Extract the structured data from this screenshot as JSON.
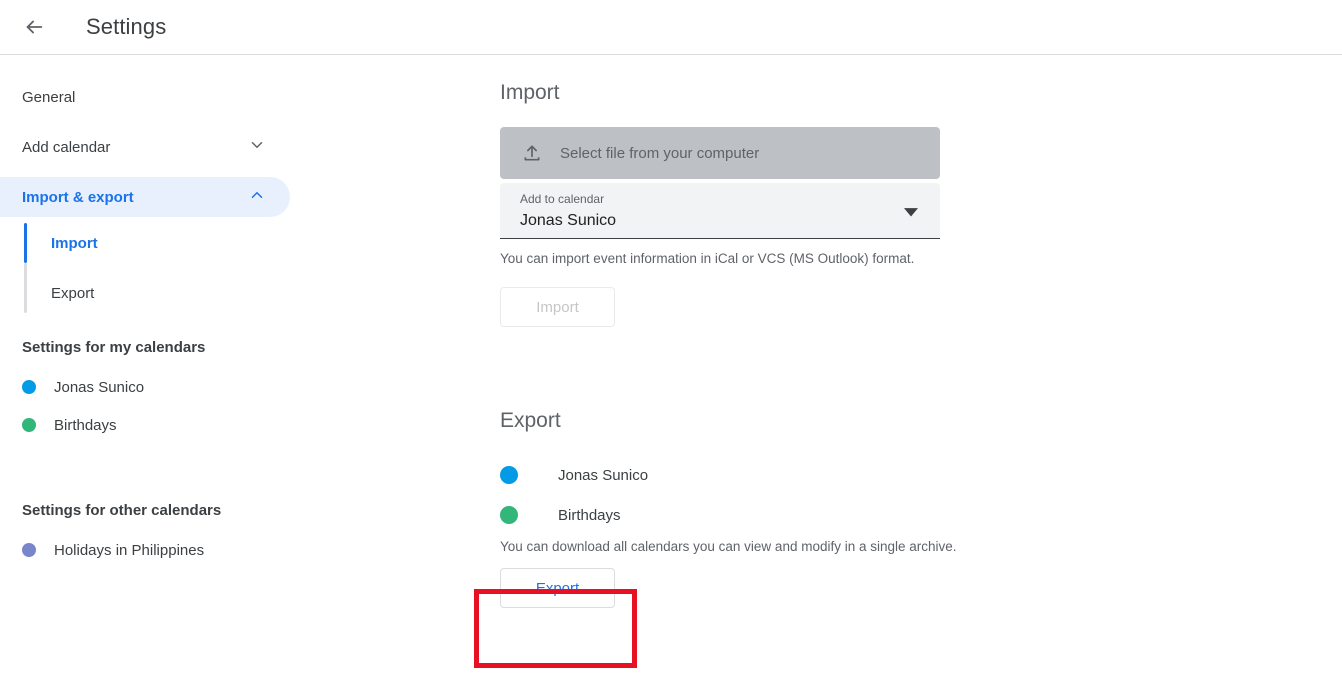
{
  "header": {
    "title": "Settings",
    "back_icon": "arrow-left-icon"
  },
  "sidebar": {
    "nav": [
      {
        "label": "General",
        "icon": null,
        "active": false
      },
      {
        "label": "Add calendar",
        "icon": "chevron-down-icon",
        "active": false
      },
      {
        "label": "Import & export",
        "icon": "chevron-up-icon",
        "active": true
      }
    ],
    "subnav": [
      {
        "label": "Import",
        "active": true
      },
      {
        "label": "Export",
        "active": false
      }
    ],
    "my_calendars_title": "Settings for my calendars",
    "my_calendars": [
      {
        "name": "Jonas Sunico",
        "color": "#039be5"
      },
      {
        "name": "Birthdays",
        "color": "#33b679"
      }
    ],
    "other_calendars_title": "Settings for other calendars",
    "other_calendars": [
      {
        "name": "Holidays in Philippines",
        "color": "#7986cb"
      }
    ]
  },
  "main": {
    "import": {
      "heading": "Import",
      "select_file_label": "Select file from your computer",
      "select_file_icon": "file-upload-icon",
      "add_to_calendar_label": "Add to calendar",
      "add_to_calendar_value": "Jonas Sunico",
      "dropdown_icon": "dropdown-arrow-icon",
      "helper_text": "You can import event information in iCal or VCS (MS Outlook) format.",
      "import_button_label": "Import"
    },
    "export": {
      "heading": "Export",
      "calendars": [
        {
          "name": "Jonas Sunico",
          "color": "#039be5"
        },
        {
          "name": "Birthdays",
          "color": "#33b679"
        }
      ],
      "helper_text": "You can download all calendars you can view and modify in a single archive.",
      "export_button_label": "Export"
    }
  },
  "annotation": {
    "highlight_color": "#e81123",
    "target": "export-button"
  }
}
